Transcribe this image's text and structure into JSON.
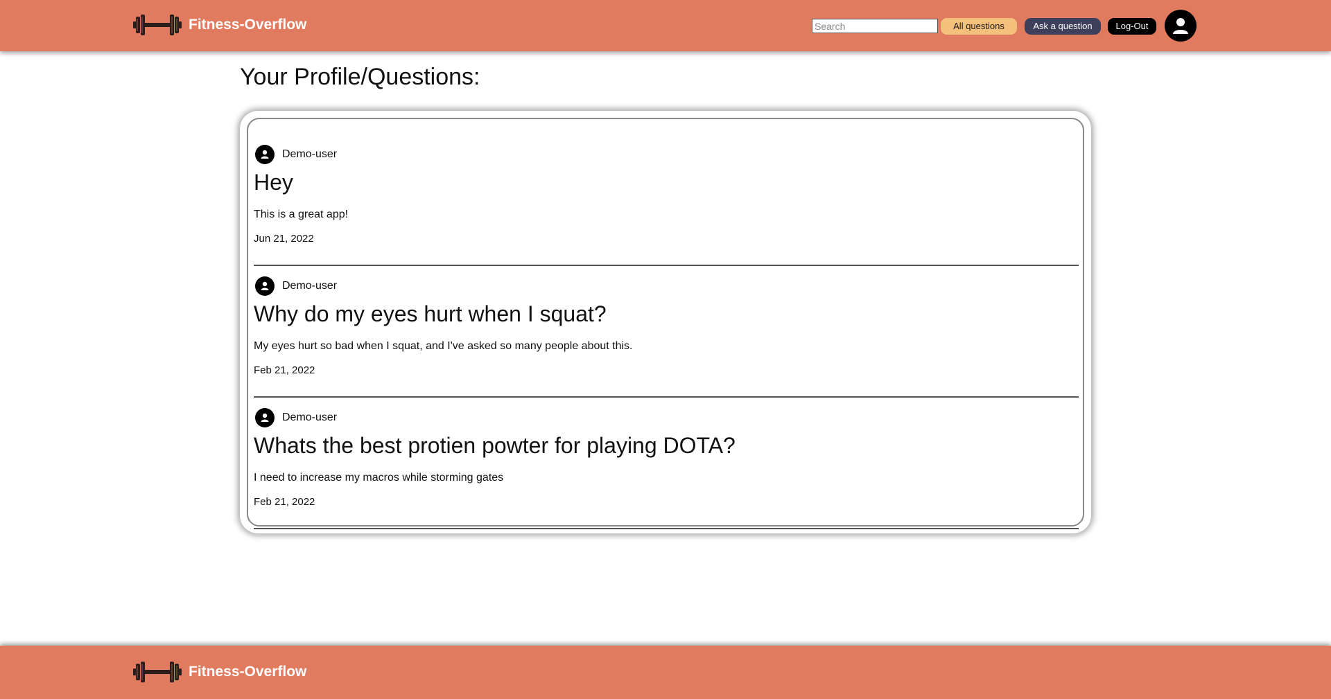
{
  "header": {
    "brand_name": "Fitness-Overflow",
    "logo_icon": "dumbbell-icon",
    "search_placeholder": "Search",
    "all_questions_label": "All questions",
    "ask_question_label": "Ask a question",
    "logout_label": "Log-Out",
    "avatar_icon": "user-icon"
  },
  "main": {
    "title": "Your Profile/Questions:",
    "questions": [
      {
        "author": "Demo-user",
        "title": "Hey",
        "body": "This is a great app!",
        "date": "Jun 21, 2022"
      },
      {
        "author": "Demo-user",
        "title": "Why do my eyes hurt when I squat?",
        "body": "My eyes hurt so bad when I squat, and I've asked so many people about this.",
        "date": "Feb 21, 2022"
      },
      {
        "author": "Demo-user",
        "title": "Whats the best protien powter for playing DOTA?",
        "body": "I need to increase my macros while storming gates",
        "date": "Feb 21, 2022"
      }
    ]
  },
  "footer": {
    "brand_name": "Fitness-Overflow"
  },
  "colors": {
    "brand": "#e07b60",
    "all_questions_bg": "#f4c07c",
    "ask_question_bg": "#3e3f5a",
    "logout_bg": "#000000"
  }
}
